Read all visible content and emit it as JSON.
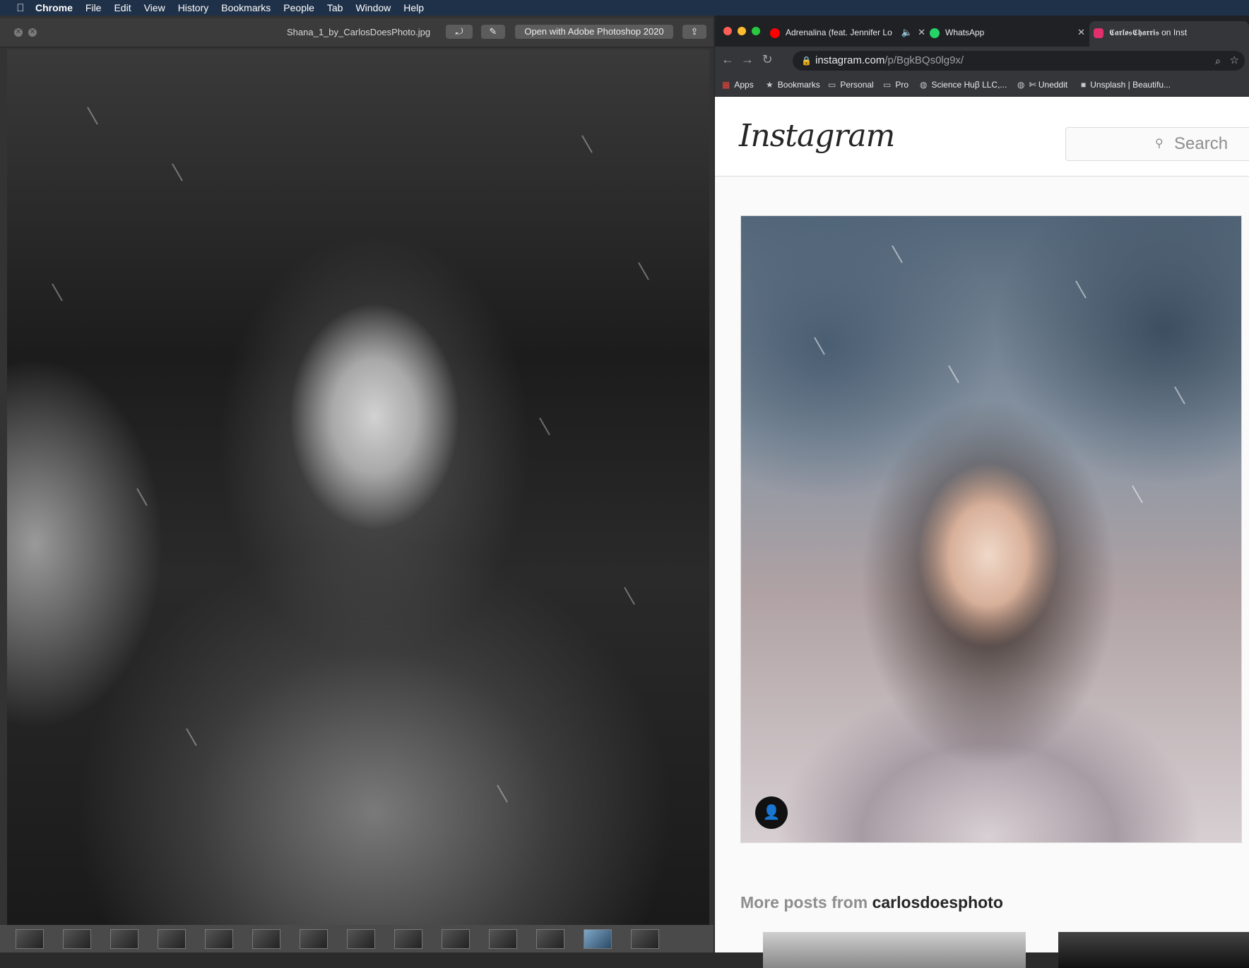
{
  "menubar": {
    "app": "Chrome",
    "items": [
      "File",
      "Edit",
      "View",
      "History",
      "Bookmarks",
      "People",
      "Tab",
      "Window",
      "Help"
    ]
  },
  "preview": {
    "filename": "Shana_1_by_CarlosDoesPhoto.jpg",
    "open_with_label": "Open with Adobe Photoshop 2020",
    "icons": [
      "close-icon",
      "fullscreen-icon",
      "rotate-icon",
      "markup-icon",
      "share-icon"
    ]
  },
  "chrome": {
    "tabs": [
      {
        "title": "Adrenalina (feat. Jennifer Lo",
        "icon": "youtube-icon",
        "color": "#ff0000"
      },
      {
        "title": "WhatsApp",
        "icon": "whatsapp-icon",
        "color": "#25d366"
      },
      {
        "title": "𝕮𝖆𝖗𝖑𝖔𝖘𝕮𝖍𝖆𝖗𝖗𝖎𝖘 on Inst",
        "icon": "instagram-icon",
        "color": "#e1306c"
      }
    ],
    "url_host": "instagram.com",
    "url_path": "/p/BgkBQs0lg9x/",
    "bookmarks": [
      "Apps",
      "Bookmarks",
      "Personal",
      "Pro",
      "Science Huβ LLC,...",
      "✄ Uneddit",
      "Unsplash | Beautifu..."
    ]
  },
  "instagram": {
    "logo": "Instagram",
    "search_placeholder": "Search",
    "more_posts_prefix": "More posts from",
    "more_posts_user": "carlosdoesphoto"
  }
}
